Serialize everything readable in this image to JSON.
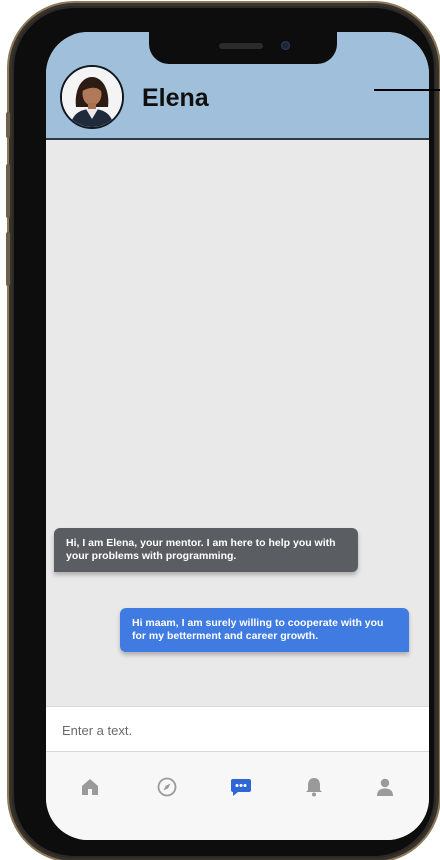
{
  "contact": {
    "name": "Elena",
    "avatar_icon": "mentor-avatar"
  },
  "messages": [
    {
      "direction": "incoming",
      "text": "Hi, I am Elena, your mentor. I am here to help you with your problems with programming."
    },
    {
      "direction": "outgoing",
      "text": "Hi maam, I am surely willing to cooperate with you for my betterment and career growth."
    }
  ],
  "input": {
    "placeholder": "Enter a text.",
    "value": ""
  },
  "nav": {
    "items": [
      {
        "icon": "home-icon",
        "active": false
      },
      {
        "icon": "compass-icon",
        "active": false
      },
      {
        "icon": "chat-icon",
        "active": true
      },
      {
        "icon": "bell-icon",
        "active": false
      },
      {
        "icon": "profile-icon",
        "active": false
      }
    ]
  },
  "colors": {
    "header": "#9fbfda",
    "incoming_bubble": "#5a5d61",
    "outgoing_bubble": "#3f7be0",
    "nav_active": "#2f66d6",
    "nav_inactive": "#9a9a9a"
  }
}
